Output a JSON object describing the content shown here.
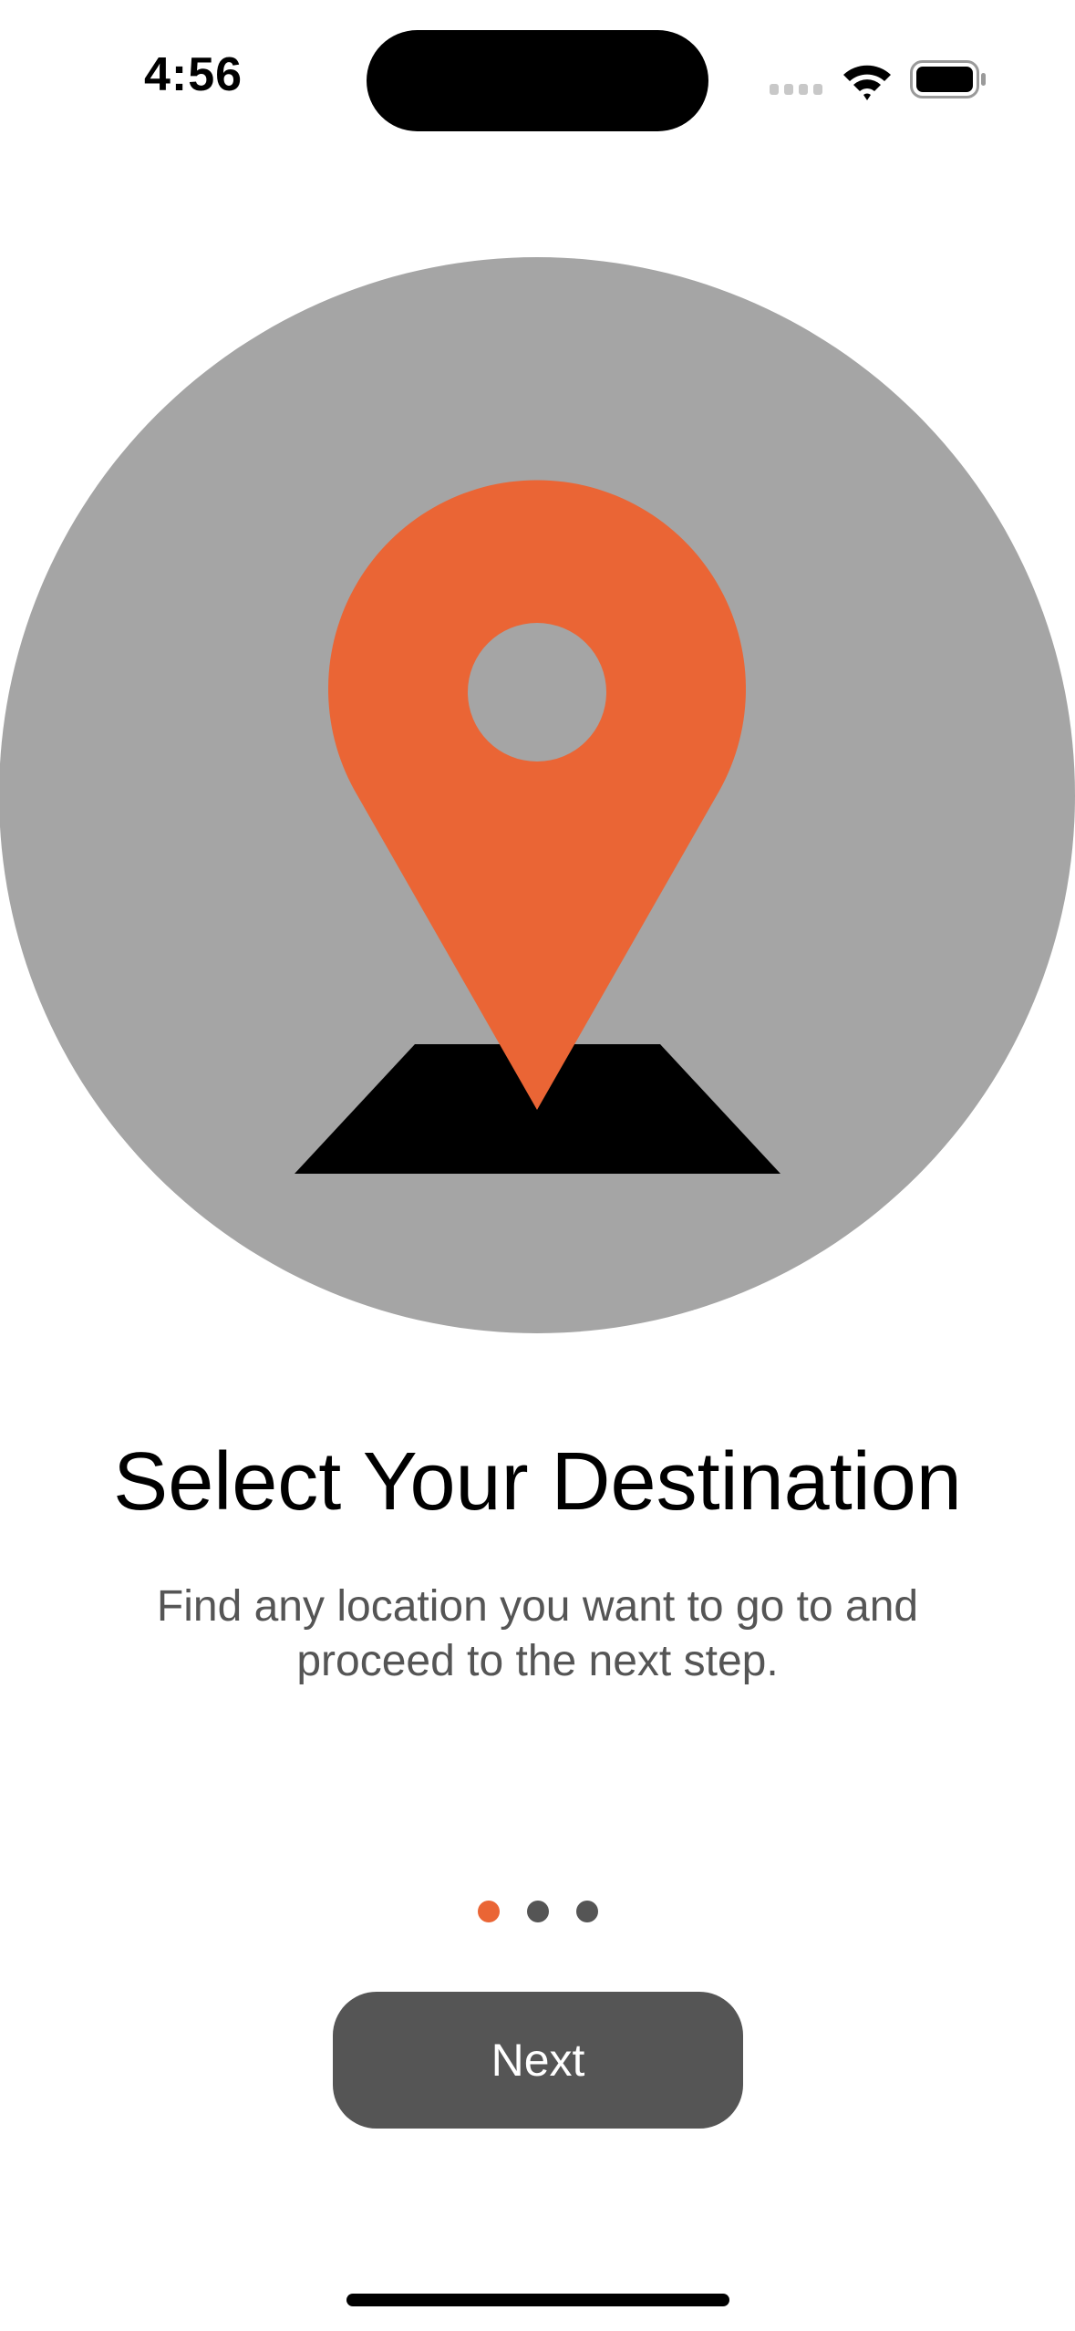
{
  "status_bar": {
    "time": "4:56",
    "icons": [
      "signal-icon",
      "wifi-icon",
      "battery-icon"
    ]
  },
  "illustration": {
    "icon": "map-pin-icon",
    "circle_color": "#a5a5a5",
    "pin_color": "#ea6535",
    "base_color": "#000000"
  },
  "onboarding": {
    "title": "Select Your Destination",
    "subtitle": "Find any location you want to go to and proceed to the next step.",
    "current_page": 1,
    "total_pages": 3,
    "next_label": "Next"
  },
  "colors": {
    "accent": "#ea6535",
    "button_bg": "#555555",
    "text_secondary": "#555555"
  }
}
